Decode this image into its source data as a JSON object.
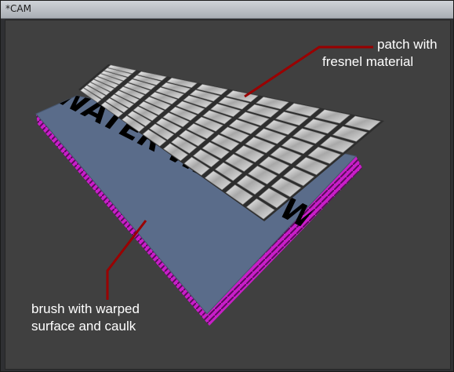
{
  "window": {
    "title": "*CAM"
  },
  "viewport": {
    "background": "#404040",
    "surface_text": "WATER WATER WATE",
    "colors": {
      "brush_top": "#5a6c8a",
      "caulk": "#c81ec8",
      "leader": "#9a0000",
      "patch_light": "#e8e8e8",
      "patch_grout": "#2e2e2e"
    }
  },
  "annotations": {
    "patch": {
      "line1": "patch with",
      "line2": "fresnel material"
    },
    "brush": {
      "line1": "brush with warped",
      "line2": "surface and caulk"
    }
  }
}
